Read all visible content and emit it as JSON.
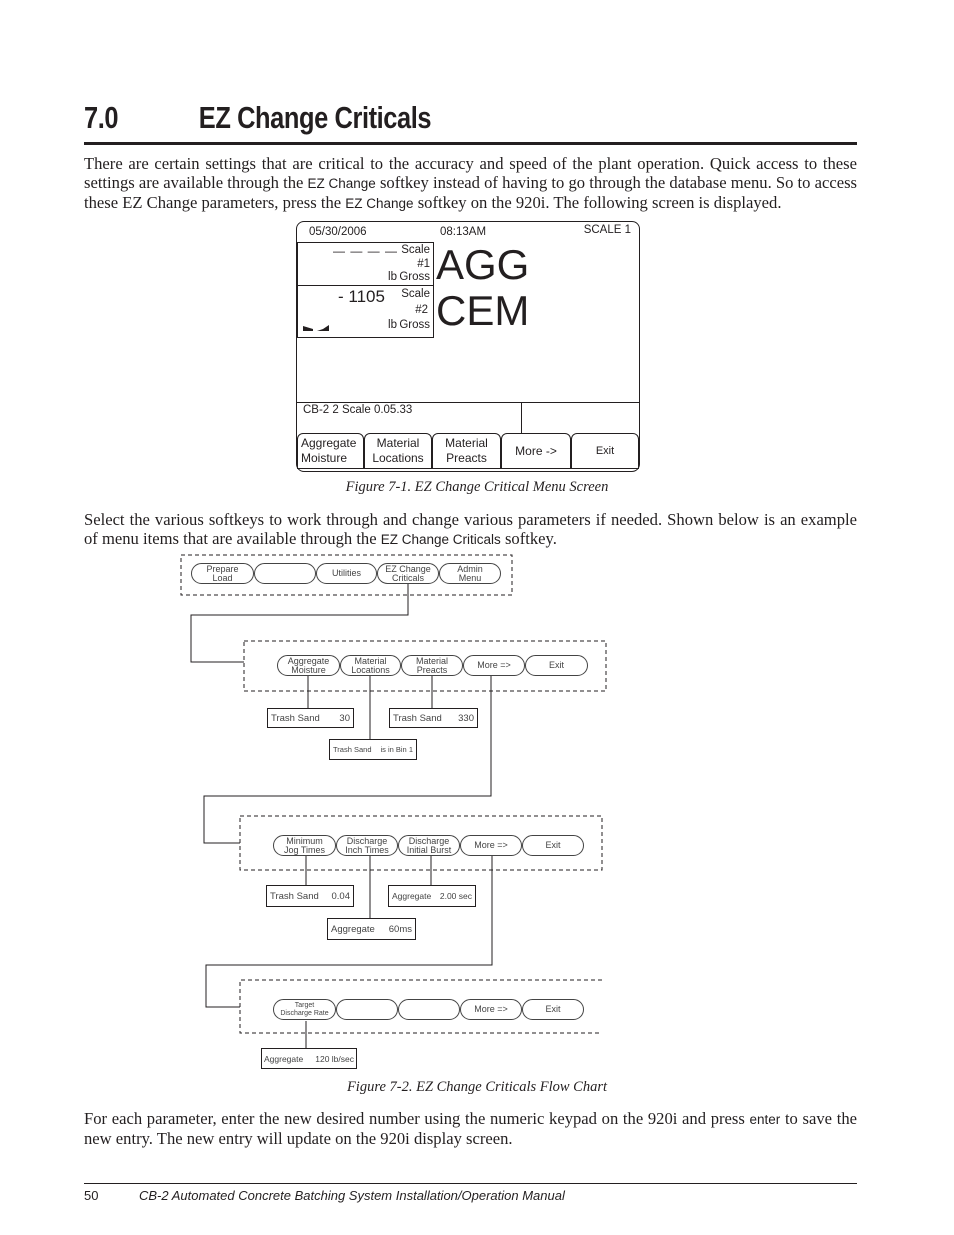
{
  "heading": {
    "number": "7.0",
    "title": "EZ Change Criticals"
  },
  "intro": {
    "p1": "There are certain settings that are critical to the accuracy and speed of the plant operation. Quick access to these settings are available through the ",
    "key1": "EZ Change",
    "p2": " softkey instead of having to go through the database menu. So to access these EZ Change parameters, press the ",
    "key2": "EZ Change",
    "p3": " softkey on the 920i. The following screen is displayed."
  },
  "screen": {
    "date": "05/30/2006",
    "time": "08:13AM",
    "scale_label": "SCALE 1",
    "scale1": {
      "value": "— — — —",
      "name": "Scale",
      "number": "#1",
      "unit": "lb",
      "mode": "Gross"
    },
    "scale2": {
      "value": "- 1105",
      "name": "Scale",
      "number": "#2",
      "unit": "lb",
      "mode": "Gross"
    },
    "line1": "AGG",
    "line2": "CEM",
    "status": "CB-2  2 Scale  0.05.33",
    "softkeys": [
      {
        "l1": "Aggregate",
        "l2": "Moisture"
      },
      {
        "l1": "Material",
        "l2": "Locations"
      },
      {
        "l1": "Material",
        "l2": "Preacts"
      },
      {
        "l1": "More ->",
        "l2": ""
      },
      {
        "l1": "Exit",
        "l2": ""
      }
    ]
  },
  "figure1_caption": "Figure 7-1. EZ Change Critical Menu Screen",
  "middle": {
    "p1": "Select the various softkeys to work through and change various parameters if needed. Shown below is an example of menu items that are available through the ",
    "key": "EZ Change Criticals",
    "p2": " softkey."
  },
  "flow": {
    "row1": [
      {
        "l1": "Prepare",
        "l2": "Load"
      },
      {
        "l1": "",
        "l2": ""
      },
      {
        "l1": "Utilities",
        "l2": ""
      },
      {
        "l1": "EZ Change",
        "l2": "Criticals"
      },
      {
        "l1": "Admin",
        "l2": "Menu"
      }
    ],
    "row2": [
      {
        "l1": "Aggregate",
        "l2": "Moisture"
      },
      {
        "l1": "Material",
        "l2": "Locations"
      },
      {
        "l1": "Material",
        "l2": "Preacts"
      },
      {
        "l1": "More =>",
        "l2": ""
      },
      {
        "l1": "Exit",
        "l2": ""
      }
    ],
    "row2_values": [
      {
        "label": "Trash Sand",
        "value": "30"
      },
      {
        "label": "Trash Sand",
        "value": "330"
      },
      {
        "label": "Trash Sand",
        "value": "is in Bin 1"
      }
    ],
    "row3": [
      {
        "l1": "Minimum",
        "l2": "Jog Times"
      },
      {
        "l1": "Discharge",
        "l2": "Inch Times"
      },
      {
        "l1": "Discharge",
        "l2": "Initial Burst"
      },
      {
        "l1": "More =>",
        "l2": ""
      },
      {
        "l1": "Exit",
        "l2": ""
      }
    ],
    "row3_values": [
      {
        "label": "Trash Sand",
        "value": "0.04"
      },
      {
        "label": "Aggregate",
        "value": "2.00 sec"
      },
      {
        "label": "Aggregate",
        "value": "60ms"
      }
    ],
    "row4": [
      {
        "l1": "Target",
        "l2": "Discharge Rate"
      },
      {
        "l1": "",
        "l2": ""
      },
      {
        "l1": "",
        "l2": ""
      },
      {
        "l1": "More =>",
        "l2": ""
      },
      {
        "l1": "Exit",
        "l2": ""
      }
    ],
    "row4_values": [
      {
        "label": "Aggregate",
        "value": "120 lb/sec"
      }
    ]
  },
  "figure2_caption": "Figure 7-2. EZ Change Criticals Flow Chart",
  "closing": {
    "p1": "For each parameter, enter the new desired number using the numeric keypad on the 920i and press ",
    "key": "enter",
    "p2": " to save the new entry. The new entry will update on the 920i display screen."
  },
  "footer": {
    "page": "50",
    "title": "CB-2 Automated Concrete Batching System Installation/Operation Manual"
  }
}
